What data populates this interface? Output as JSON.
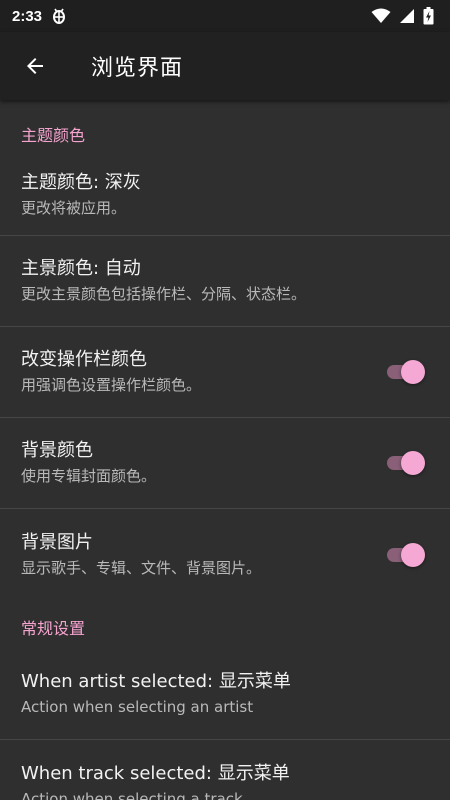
{
  "status_bar": {
    "time": "2:33",
    "notification_icon": "bug-icon",
    "wifi_icon": "wifi-icon",
    "signal_icon": "signal-icon",
    "battery_icon": "battery-charging-icon"
  },
  "app_bar": {
    "back_icon": "arrow-back-icon",
    "title": "浏览界面"
  },
  "colors": {
    "accent": "#f5a3cf",
    "background": "#2f2f2f",
    "app_bar": "#212121",
    "status_bar": "#1f1f1f",
    "divider": "#464646"
  },
  "sections": [
    {
      "header": "主题颜色",
      "items": [
        {
          "title": "主题颜色: 深灰",
          "subtitle": "更改将被应用。"
        },
        {
          "title": "主景颜色: 自动",
          "subtitle": "更改主景颜色包括操作栏、分隔、状态栏。"
        },
        {
          "title": "改变操作栏颜色",
          "subtitle": "用强调色设置操作栏颜色。",
          "toggle": true
        },
        {
          "title": "背景颜色",
          "subtitle": "使用专辑封面颜色。",
          "toggle": true
        },
        {
          "title": "背景图片",
          "subtitle": "显示歌手、专辑、文件、背景图片。",
          "toggle": true
        }
      ]
    },
    {
      "header": "常规设置",
      "items": [
        {
          "title": "When artist selected: 显示菜单",
          "subtitle": "Action when selecting an artist"
        },
        {
          "title": "When track selected: 显示菜单",
          "subtitle": "Action when selecting a track"
        }
      ]
    }
  ]
}
